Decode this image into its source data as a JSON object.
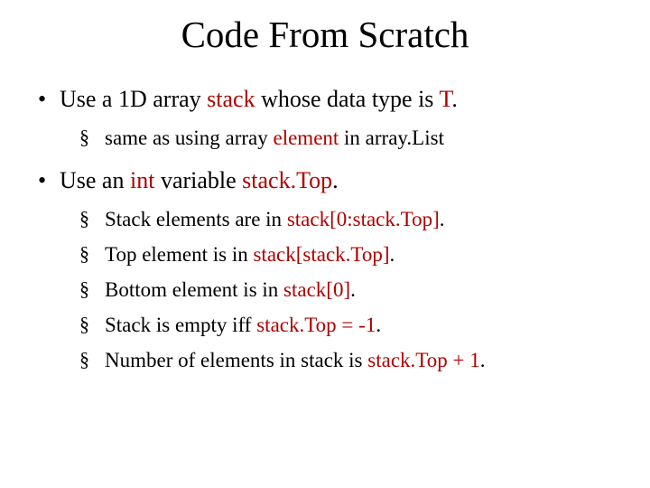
{
  "title": "Code From Scratch",
  "b1": {
    "p0": "Use a 1D array ",
    "p1": "stack",
    "p2": " whose data type is ",
    "p3": "T",
    "p4": ".",
    "sub1": {
      "p0": "same as using array ",
      "p1": "element",
      "p2": " in array.List"
    }
  },
  "b2": {
    "p0": "Use an ",
    "p1": "int",
    "p2": " variable ",
    "p3": "stack.Top",
    "p4": ".",
    "s1": {
      "p0": "Stack elements are in ",
      "p1": "stack[0:stack.Top]",
      "p2": "."
    },
    "s2": {
      "p0": "Top element is in ",
      "p1": "stack[stack.Top]",
      "p2": "."
    },
    "s3": {
      "p0": "Bottom element is in ",
      "p1": "stack[0]",
      "p2": "."
    },
    "s4": {
      "p0": "Stack is empty iff ",
      "p1": "stack.Top = -1",
      "p2": "."
    },
    "s5": {
      "p0": "Number of elements in stack is ",
      "p1": "stack.Top + 1",
      "p2": "."
    }
  }
}
